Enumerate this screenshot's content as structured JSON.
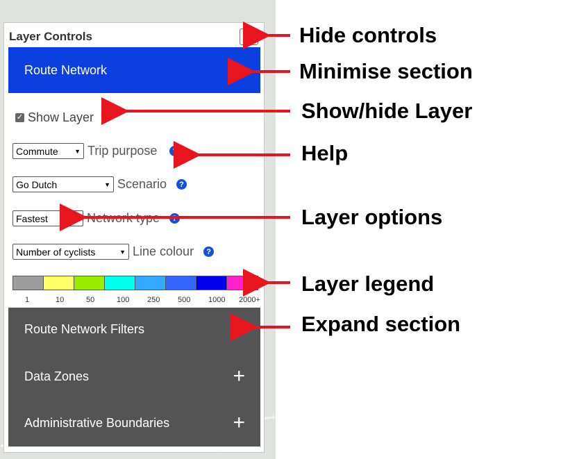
{
  "panel": {
    "title": "Layer Controls",
    "close_symbol": "×"
  },
  "route_section": {
    "label": "Route Network",
    "control": "minimise",
    "color": "#0b3fe0"
  },
  "show_layer": {
    "label": "Show Layer",
    "checked": true
  },
  "options": [
    {
      "selected": "Commute",
      "label": "Trip purpose"
    },
    {
      "selected": "Go Dutch",
      "label": "Scenario"
    },
    {
      "selected": "Fastest",
      "label": "Network type"
    },
    {
      "selected": "Number of cyclists",
      "label": "Line colour"
    }
  ],
  "help_symbol": "?",
  "legend": {
    "colors": [
      "#9e9e9e",
      "#ffff66",
      "#99ee00",
      "#00ffee",
      "#33aaff",
      "#3366ff",
      "#0000ee",
      "#ff22cc"
    ],
    "labels": [
      "1",
      "10",
      "50",
      "100",
      "250",
      "500",
      "1000",
      "2000+"
    ]
  },
  "collapsed_sections": [
    {
      "label": "Route Network Filters",
      "control": "+"
    },
    {
      "label": "Data Zones",
      "control": "+"
    },
    {
      "label": "Administrative Boundaries",
      "control": "+"
    }
  ],
  "annotations": {
    "hide_controls": "Hide controls",
    "minimise_section": "Minimise section",
    "show_hide_layer": "Show/hide Layer",
    "help": "Help",
    "layer_options": "Layer options",
    "layer_legend": "Layer legend",
    "expand_section": "Expand section",
    "arrow_color": "#e8141e"
  }
}
